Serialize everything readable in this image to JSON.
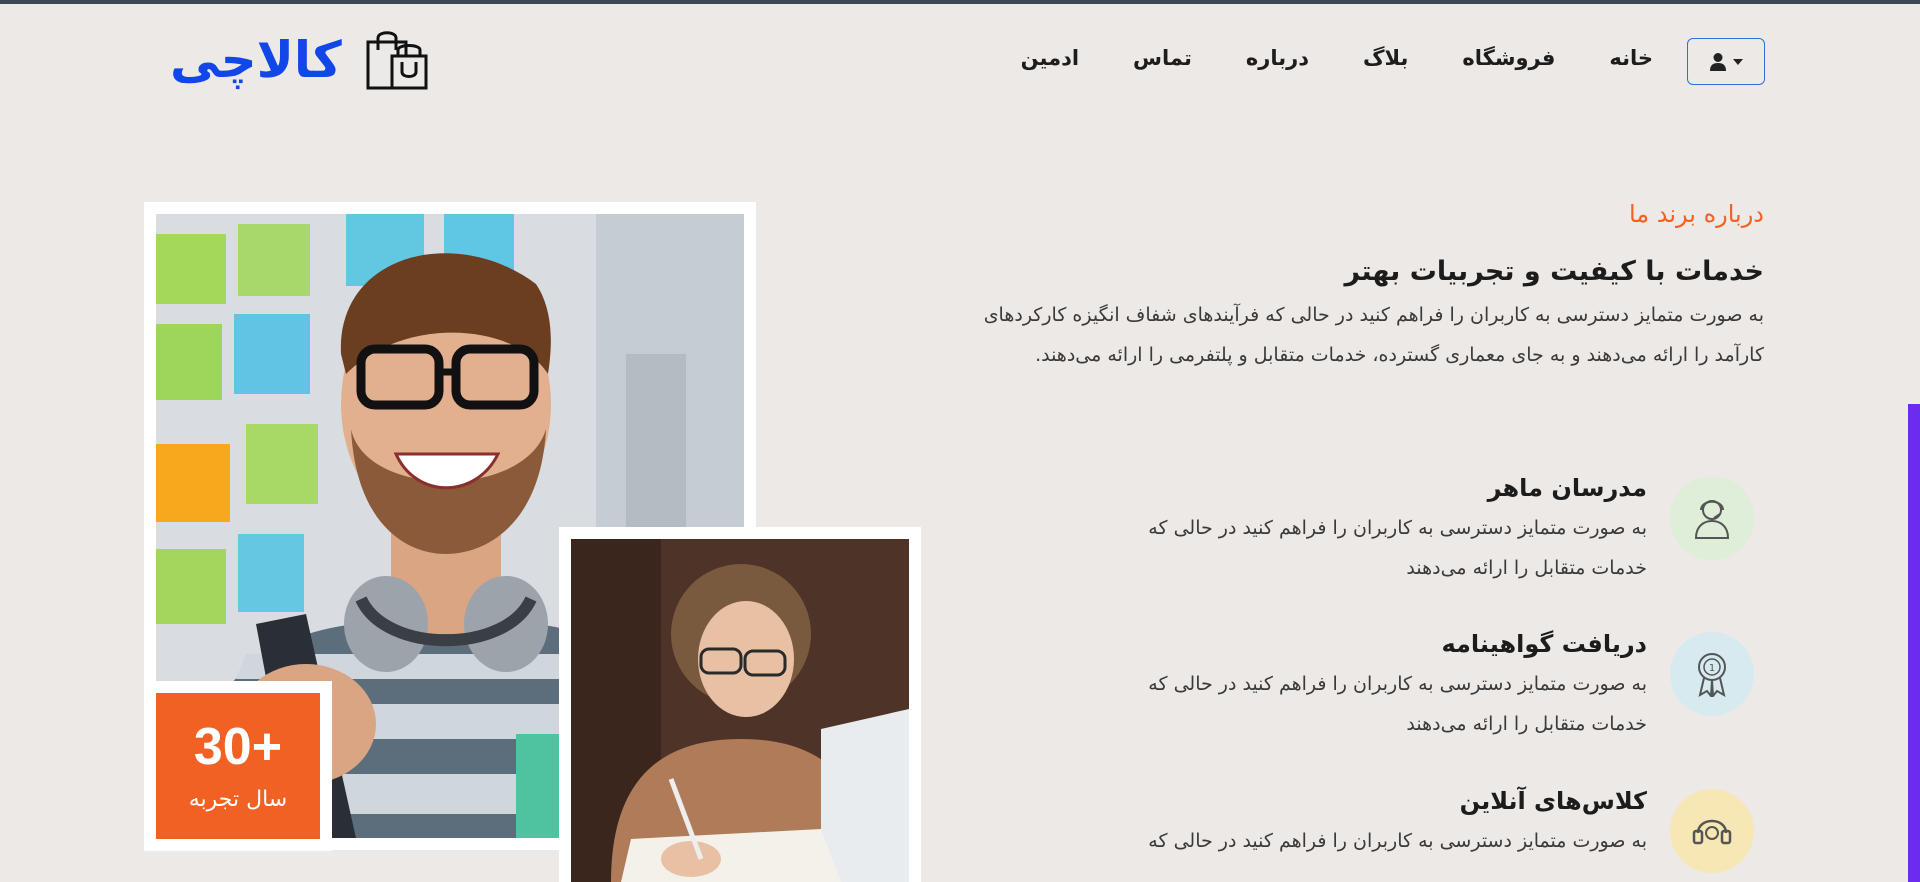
{
  "header": {
    "logo_text": "کالاچی",
    "nav": [
      "خانه",
      "فروشگاه",
      "بلاگ",
      "درباره",
      "تماس",
      "ادمین"
    ],
    "user_icon": "user-icon",
    "user_menu_icon": "caret-down-icon"
  },
  "about": {
    "kicker": "درباره برند ما",
    "heading": "خدمات با کیفیت و تجربیات بهتر",
    "intro": "به صورت متمایز دسترسی به کاربران را فراهم کنید در حالی که فرآیندهای شفاف انگیزه کارکردهای کارآمد را ارائه می‌دهند و به جای معماری گسترده، خدمات متقابل و پلتفرمی را ارائه می‌دهند."
  },
  "experience": {
    "number": "30+",
    "label": "سال تجربه"
  },
  "features": [
    {
      "title": "مدرسان ماهر",
      "desc": "به صورت متمایز دسترسی به کاربران را فراهم کنید در حالی که خدمات متقابل را ارائه می‌دهند",
      "icon": "instructor-icon",
      "color": "#dfeed8"
    },
    {
      "title": "دریافت گواهینامه",
      "desc": "به صورت متمایز دسترسی به کاربران را فراهم کنید در حالی که خدمات متقابل را ارائه می‌دهند",
      "icon": "certificate-icon",
      "color": "#d7eaf0"
    },
    {
      "title": "کلاس‌های آنلاین",
      "desc": "به صورت متمایز دسترسی به کاربران را فراهم کنید در حالی که",
      "icon": "online-class-icon",
      "color": "#f7e7b4"
    }
  ],
  "colors": {
    "accent": "#f26124",
    "brand": "#1146e8",
    "background": "#ede9e6",
    "scrollbar": "#6b2cf0"
  }
}
